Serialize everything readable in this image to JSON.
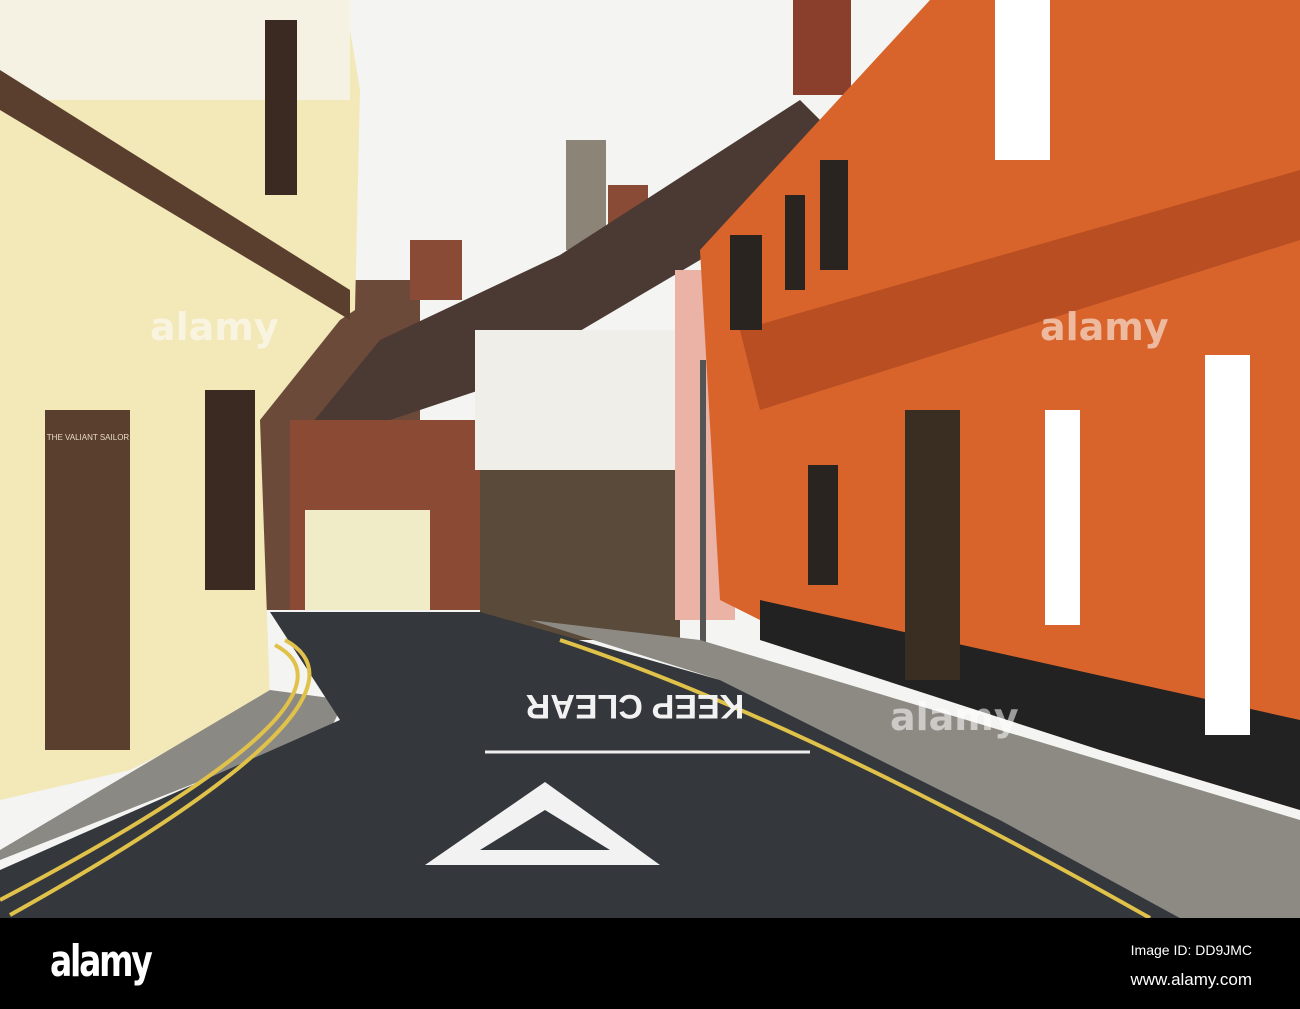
{
  "photo": {
    "sign_text": "THE VALIANT SAILOR",
    "road_marking": "KEEP CLEAR",
    "watermark": "alamy",
    "colors": {
      "sky": "#f4f4f2",
      "orange": "#d8632a",
      "cream": "#f3e8b8",
      "road": "#2f3236",
      "brick": "#7a4a36"
    }
  },
  "footer": {
    "logo": "alamy",
    "image_id": "Image ID: DD9JMC",
    "url": "www.alamy.com"
  }
}
